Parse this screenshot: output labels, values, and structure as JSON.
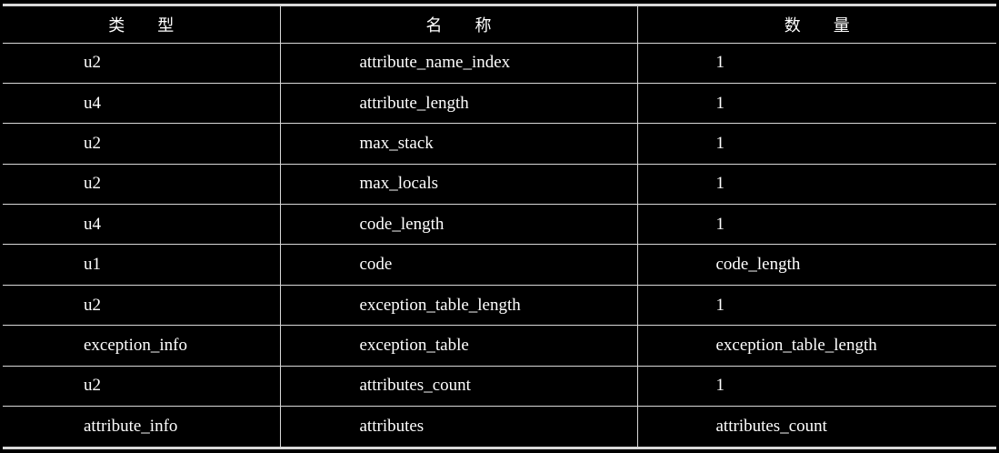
{
  "table": {
    "headers": [
      "类型",
      "名称",
      "数量"
    ],
    "rows": [
      {
        "type": "u2",
        "name": "attribute_name_index",
        "count": "1"
      },
      {
        "type": "u4",
        "name": "attribute_length",
        "count": "1"
      },
      {
        "type": "u2",
        "name": "max_stack",
        "count": "1"
      },
      {
        "type": "u2",
        "name": "max_locals",
        "count": "1"
      },
      {
        "type": "u4",
        "name": "code_length",
        "count": "1"
      },
      {
        "type": "u1",
        "name": "code",
        "count": "code_length"
      },
      {
        "type": "u2",
        "name": "exception_table_length",
        "count": "1"
      },
      {
        "type": "exception_info",
        "name": "exception_table",
        "count": "exception_table_length"
      },
      {
        "type": "u2",
        "name": "attributes_count",
        "count": "1"
      },
      {
        "type": "attribute_info",
        "name": "attributes",
        "count": "attributes_count"
      }
    ]
  },
  "colors": {
    "background": "#000000",
    "text": "#ffffff",
    "rule": "#d8d8d8"
  }
}
